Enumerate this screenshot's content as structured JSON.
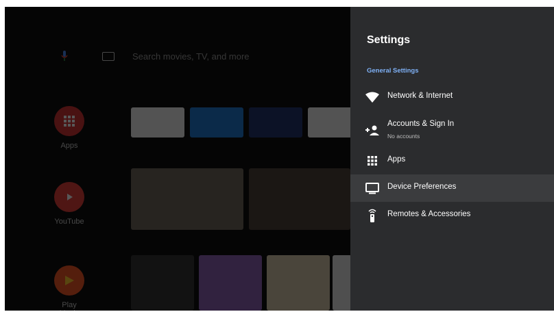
{
  "search": {
    "placeholder": "Search movies, TV, and more"
  },
  "home": {
    "apps": [
      {
        "label": "Apps",
        "icon": "apps-grid-icon",
        "color": "#d32f2f"
      },
      {
        "label": "YouTube",
        "icon": "youtube-play-icon",
        "color": "#e53935"
      },
      {
        "label": "Play Music",
        "icon": "play-music-icon",
        "color": "#f4511e"
      }
    ]
  },
  "settings": {
    "title": "Settings",
    "section": "General Settings",
    "items": [
      {
        "label": "Network & Internet",
        "icon": "wifi-icon"
      },
      {
        "label": "Accounts & Sign In",
        "sub": "No accounts",
        "icon": "add-person-icon"
      },
      {
        "label": "Apps",
        "icon": "apps-grid-icon"
      },
      {
        "label": "Device Preferences",
        "icon": "tv-icon",
        "selected": true
      },
      {
        "label": "Remotes & Accessories",
        "icon": "remote-icon"
      }
    ],
    "accent": "#7fb1f6"
  }
}
